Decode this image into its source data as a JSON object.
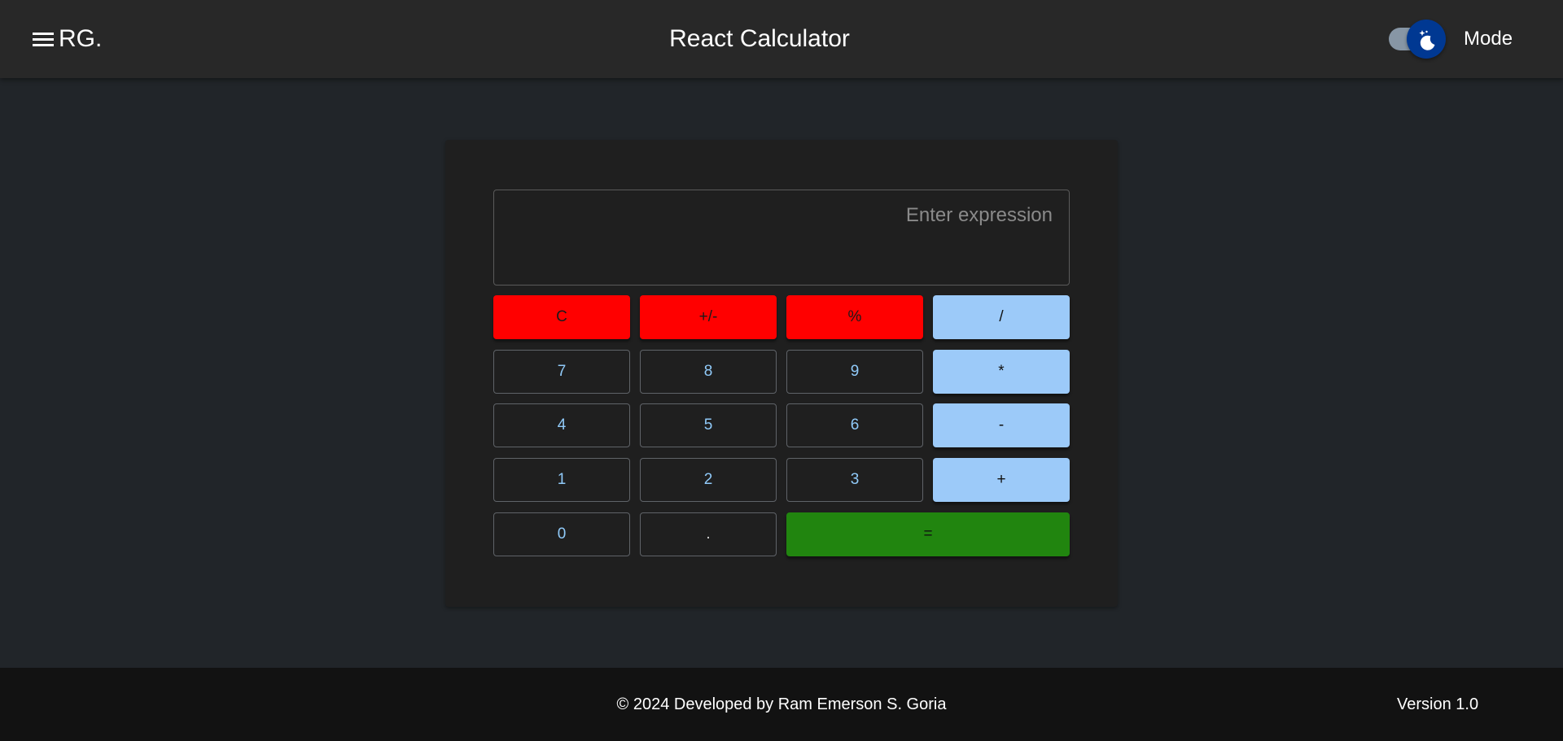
{
  "header": {
    "brand": "RG.",
    "title": "React Calculator",
    "mode_label": "Mode",
    "mode_toggle_state": "dark"
  },
  "calculator": {
    "display_value": "",
    "display_placeholder": "Enter expression",
    "keys": {
      "clear": "C",
      "negate": "+/-",
      "percent": "%",
      "divide": "/",
      "seven": "7",
      "eight": "8",
      "nine": "9",
      "multiply": "*",
      "four": "4",
      "five": "5",
      "six": "6",
      "subtract": "-",
      "one": "1",
      "two": "2",
      "three": "3",
      "add": "+",
      "zero": "0",
      "decimal": ".",
      "equals": "="
    }
  },
  "footer": {
    "credit": "© 2024 Developed by Ram Emerson S. Goria",
    "version": "Version 1.0"
  },
  "icons": {
    "menu": "hamburger-menu-icon",
    "mode": "moon-stars-icon"
  },
  "colors": {
    "background": "#212529",
    "appbar": "#282828",
    "card": "#1f1f1f",
    "footer": "#121212",
    "clear_keys": "#ff0000",
    "operator_keys": "#9ccaf9",
    "number_text": "#90caf9",
    "equals_key": "#21850f",
    "toggle_thumb": "#003892"
  }
}
